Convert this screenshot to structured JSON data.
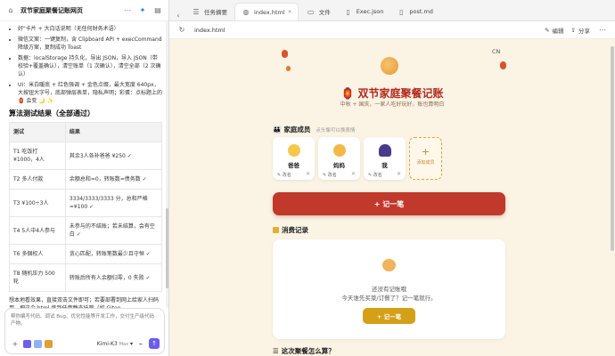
{
  "left": {
    "title": "双节家庭聚餐记账网页",
    "chat_lines": [
      "好\"卡片 + 大白话说明（无任何财务术语）",
      "微信文案：一键复制，含 Clipboard API + execCommand 降级方案，复制成功 Toast",
      "数据：localStorage 持久化，导出 JSON，导入 JSON（带校验+覆盖确认），清空账单（1 次确认），清空全部（2 次确认）",
      "UI：米白暖底 + 红色强调 + 金色点缀，最大宽度 640px，大按钮大字号，底部弹层表单，隐私声明；彩蛋：点标题上的 🏮 会变 🌙 ✨"
    ],
    "results_heading": "算法测试结果（全部通过）",
    "table": {
      "headers": [
        "测试",
        "结果"
      ],
      "rows": [
        [
          "T1 吃饭打 ¥1000，4人",
          "其余3人各补爸爸 ¥250 ✓"
        ],
        [
          "T2 多人付款",
          "余额总和=0，转账数=债务数 ✓"
        ],
        [
          "T3 ¥100÷3人",
          "3334/3333/3333 分，总和严格 =¥100 ✓"
        ],
        [
          "T4 5人中4人参与",
          "未参与的不结账；若未结算，会有空白 ✓"
        ],
        [
          "T6 多個权人",
          "贪心匹配，转账笔数最少且守恒 ✓"
        ],
        [
          "T8 随机压力 500 轮",
          "转账后所有人余额归零，0 失败 ✓"
        ]
      ]
    },
    "after_text": "想本地看效果，直接双击文件即可；若要部署到网上给家人扫码用，把这个 html 传到任意静态托管（如 Gitee",
    "composer_placeholder": "帮你编写代码、调试 Bug、优化性能等开发工作，交付生产级代码产物。",
    "model_label": "Kimi-K3",
    "model_suffix": "Max"
  },
  "tabs": [
    {
      "label": "任务摘要",
      "icon": "list-icon"
    },
    {
      "label": "index.html",
      "icon": "globe-icon",
      "active": true
    },
    {
      "label": "文件",
      "icon": "folder-icon"
    },
    {
      "label": "Exec.json",
      "icon": "file-icon"
    },
    {
      "label": "post.md",
      "icon": "file-icon"
    }
  ],
  "addressbar": {
    "url": "index.html",
    "edit_label": "编辑",
    "share_label": "分享"
  },
  "app": {
    "lang": "CN",
    "title": "🏮 双节家庭聚餐记账",
    "subtitle": "中秋 + 国庆，一家人吃好玩好，账也算明白",
    "members_heading": "家庭成员",
    "members_hint": "点头像可以换表情",
    "members": [
      {
        "name": "爸爸",
        "emoji": "👴"
      },
      {
        "name": "妈妈",
        "emoji": "👩"
      },
      {
        "name": "我",
        "emoji": "👤"
      }
    ],
    "rename_label": "改名",
    "add_member_label": "添加成员",
    "record_button": "+ 记一笔",
    "expenses_heading": "消费记录",
    "empty_line1": "还没有记账哦",
    "empty_line2": "今天谁先买菜/订餐了？记一笔就行。",
    "empty_button": "+ 记一笔",
    "faq_heading": "这次聚餐怎么算？"
  },
  "colors": {
    "accent": "#c0392b",
    "gold": "#d4a017",
    "bg": "#fbf3e4"
  }
}
